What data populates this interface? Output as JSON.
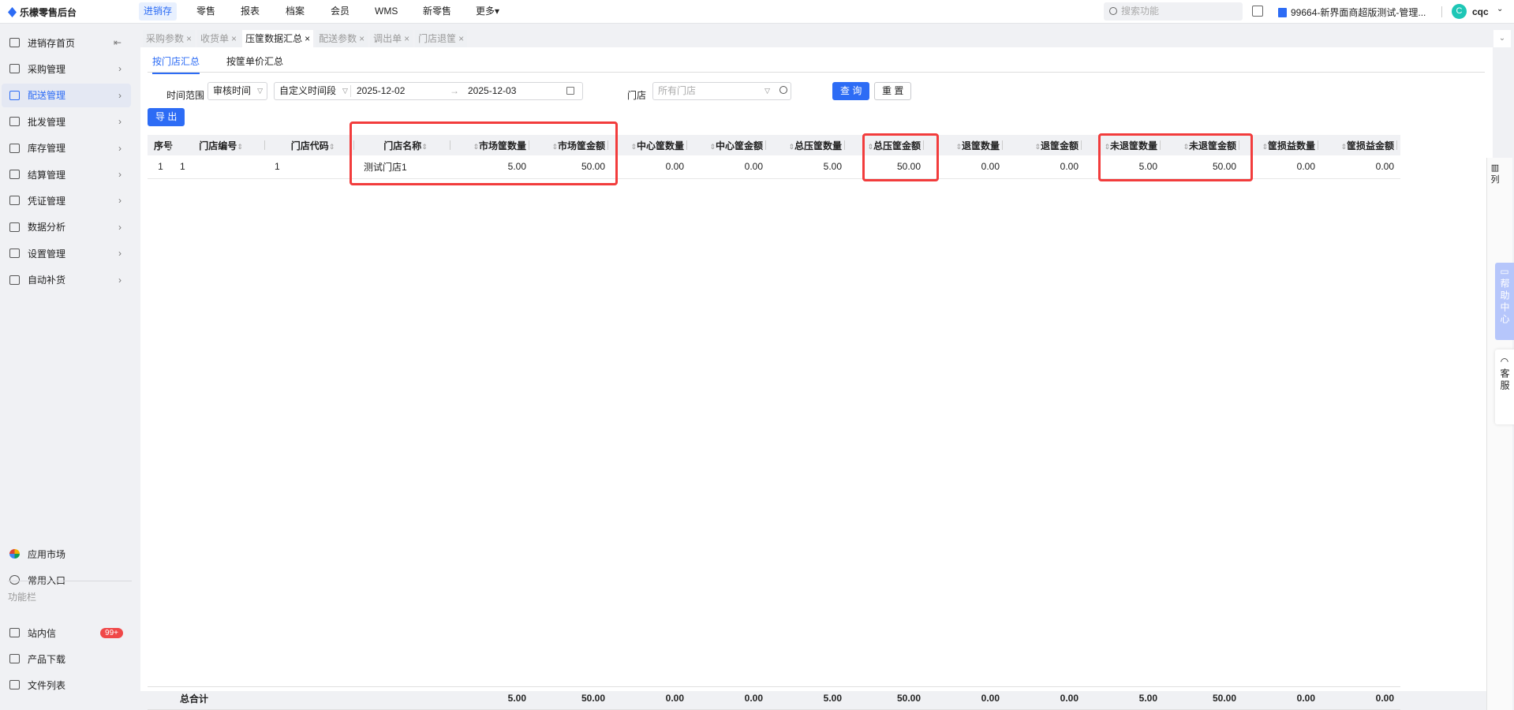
{
  "app": {
    "title": "乐檬零售后台"
  },
  "topnav": [
    "进销存",
    "零售",
    "报表",
    "档案",
    "会员",
    "WMS",
    "新零售",
    "更多▾"
  ],
  "search": {
    "placeholder": "搜索功能"
  },
  "org": "99664-新界面商超版测试-管理...",
  "user": {
    "initial": "C",
    "name": "cqc"
  },
  "sidebar": {
    "items": [
      "进销存首页",
      "采购管理",
      "配送管理",
      "批发管理",
      "库存管理",
      "结算管理",
      "凭证管理",
      "数据分析",
      "设置管理",
      "自动补货"
    ],
    "bottom": [
      "应用市场",
      "常用入口"
    ],
    "section": "功能栏",
    "tools": [
      "站内信",
      "产品下载",
      "文件列表"
    ],
    "badge": "99+"
  },
  "tabs": [
    "采购参数",
    "收货单",
    "压筐数据汇总",
    "配送参数",
    "调出单",
    "门店退筐"
  ],
  "subtabs": [
    "按门店汇总",
    "按筐单价汇总"
  ],
  "filters": {
    "time_label": "时间范围",
    "time_type": "审核时间",
    "period": "自定义时间段",
    "start": "2025-12-02",
    "end": "2025-12-03",
    "store_label": "门店",
    "store_placeholder": "所有门店",
    "query": "查 询",
    "reset": "重 置",
    "export": "导 出"
  },
  "table": {
    "columns": [
      "序号",
      "门店编号",
      "门店代码",
      "门店名称",
      "市场筐数量",
      "市场筐金额",
      "中心筐数量",
      "中心筐金额",
      "总压筐数量",
      "总压筐金额",
      "退筐数量",
      "退筐金额",
      "未退筐数量",
      "未退筐金额",
      "筐损益数量",
      "筐损益金额"
    ],
    "rows": [
      [
        "1",
        "1",
        "1",
        "测试门店1",
        "5.00",
        "50.00",
        "0.00",
        "0.00",
        "5.00",
        "50.00",
        "0.00",
        "0.00",
        "5.00",
        "50.00",
        "0.00",
        "0.00"
      ]
    ],
    "totals": [
      "",
      "总合计",
      "",
      "",
      "5.00",
      "50.00",
      "0.00",
      "0.00",
      "5.00",
      "50.00",
      "0.00",
      "0.00",
      "5.00",
      "50.00",
      "0.00",
      "0.00"
    ]
  },
  "column_settings": "列",
  "help": "帮助中心",
  "service": "客服"
}
